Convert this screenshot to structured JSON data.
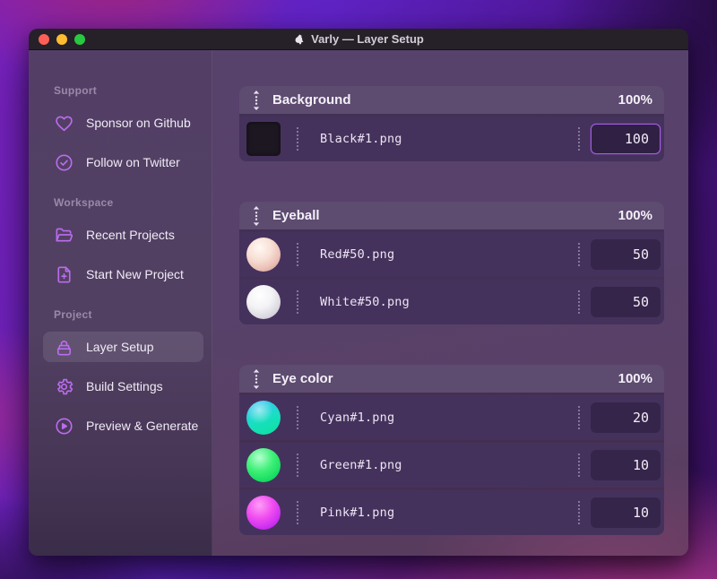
{
  "window": {
    "title": "Varly — Layer Setup",
    "app_icon": "unicorn-icon",
    "traffic_lights": {
      "close": "red",
      "minimize": "yellow",
      "zoom": "green"
    }
  },
  "sidebar": {
    "sections": [
      {
        "label": "Support",
        "items": [
          {
            "icon": "heart-icon",
            "label": "Sponsor on Github",
            "active": false
          },
          {
            "icon": "check-circle-icon",
            "label": "Follow on Twitter",
            "active": false
          }
        ]
      },
      {
        "label": "Workspace",
        "items": [
          {
            "icon": "folder-icon",
            "label": "Recent Projects",
            "active": false
          },
          {
            "icon": "file-plus-icon",
            "label": "Start New Project",
            "active": false
          }
        ]
      },
      {
        "label": "Project",
        "items": [
          {
            "icon": "layers-icon",
            "label": "Layer Setup",
            "active": true
          },
          {
            "icon": "gear-icon",
            "label": "Build Settings",
            "active": false
          },
          {
            "icon": "play-circle-icon",
            "label": "Preview & Generate",
            "active": false
          }
        ]
      }
    ]
  },
  "layers": {
    "groups": [
      {
        "name": "Background",
        "weight": "100%",
        "items": [
          {
            "file": "Black#1.png",
            "value": "100",
            "thumb": "black-square",
            "focused": true
          }
        ]
      },
      {
        "name": "Eyeball",
        "weight": "100%",
        "items": [
          {
            "file": "Red#50.png",
            "value": "50",
            "thumb": "red-ball",
            "focused": false
          },
          {
            "file": "White#50.png",
            "value": "50",
            "thumb": "white-ball",
            "focused": false
          }
        ]
      },
      {
        "name": "Eye color",
        "weight": "100%",
        "items": [
          {
            "file": "Cyan#1.png",
            "value": "20",
            "thumb": "cyan-ball",
            "focused": false
          },
          {
            "file": "Green#1.png",
            "value": "10",
            "thumb": "green-ball",
            "focused": false
          },
          {
            "file": "Pink#1.png",
            "value": "10",
            "thumb": "pink-ball",
            "focused": false
          }
        ]
      }
    ]
  },
  "colors": {
    "accent": "#a45ce6",
    "sidebar_icon": "#bb6cee",
    "header_bg": "#5d4b70",
    "row_bg": "#45325c",
    "titlebar_bg": "#262029",
    "traffic_red": "#ff5f57",
    "traffic_yellow": "#febc2e",
    "traffic_green": "#28c840"
  }
}
